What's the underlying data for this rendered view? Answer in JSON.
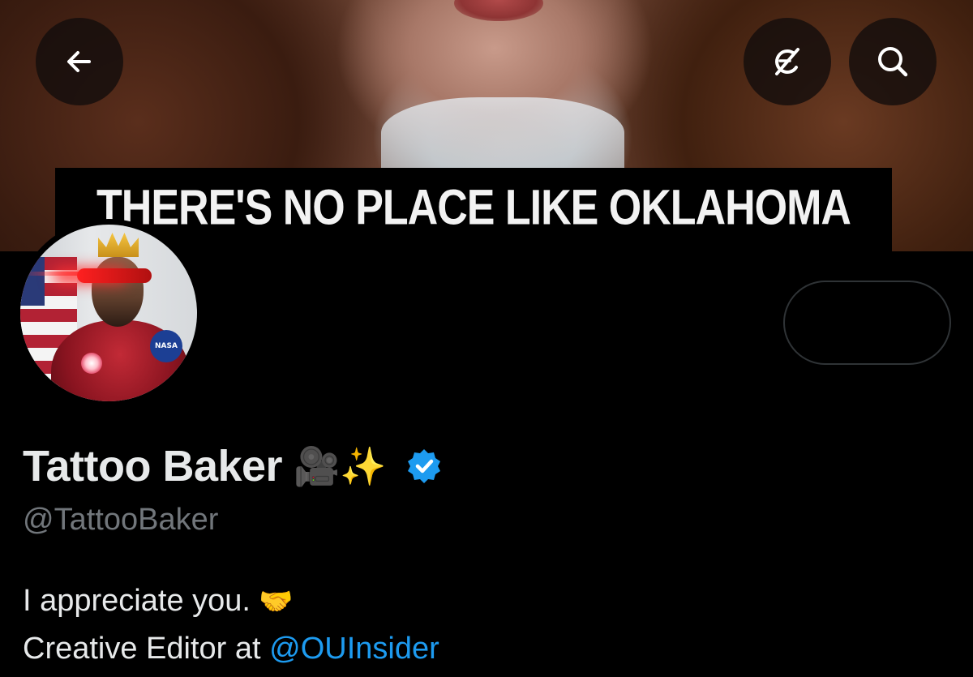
{
  "header": {
    "banner_caption": "THERE'S NO PLACE LIKE OKLAHOMA",
    "icons": {
      "back": "back-arrow-icon",
      "grok": "grok-icon",
      "search": "search-icon"
    }
  },
  "profile": {
    "display_name": "Tattoo Baker",
    "name_emojis": "🎥✨",
    "verified": true,
    "verified_color": "#1d9bf0",
    "handle": "@TattooBaker",
    "bio": {
      "line1_text": "I appreciate you.",
      "line1_emoji": "🤝",
      "line2_text": "Creative Editor at ",
      "line2_mention": "@OUInsider"
    },
    "avatar_badge": "NASA"
  },
  "colors": {
    "background": "#000000",
    "text_primary": "#e7e9ea",
    "text_secondary": "#71767b",
    "link": "#1d9bf0"
  }
}
